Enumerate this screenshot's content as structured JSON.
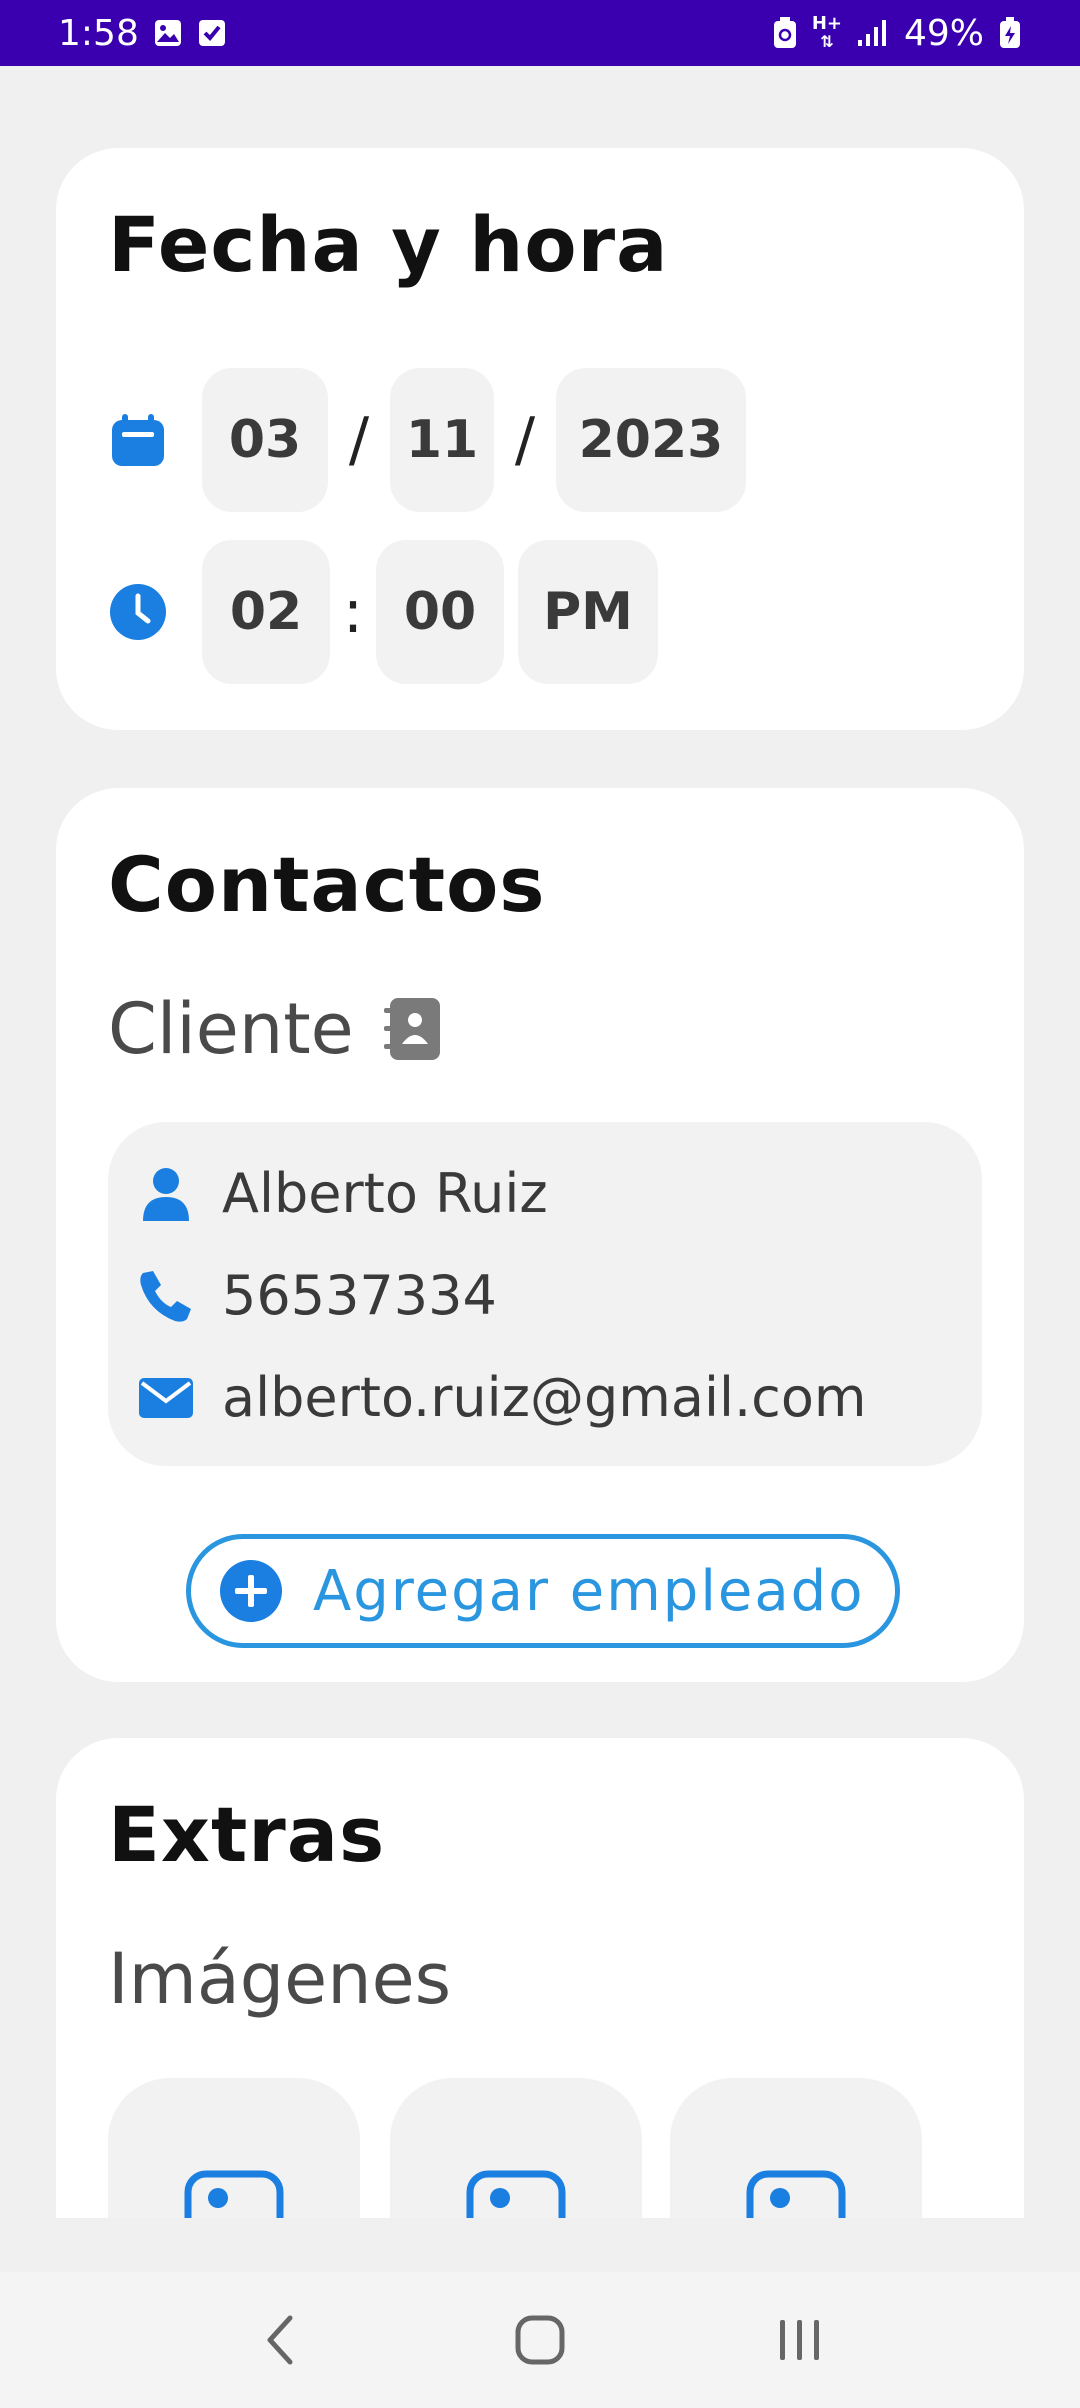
{
  "status_bar": {
    "time": "1:58",
    "battery": "49%",
    "network": "H+"
  },
  "datetime_card": {
    "title": "Fecha y hora",
    "date": {
      "day": "03",
      "sep1": "/",
      "month": "11",
      "sep2": "/",
      "year": "2023"
    },
    "time": {
      "hour": "02",
      "sep": ":",
      "minute": "00",
      "period": "PM"
    }
  },
  "contacts_card": {
    "title": "Contactos",
    "client_label": "Cliente",
    "client": {
      "name": "Alberto Ruiz",
      "phone": "56537334",
      "email": "alberto.ruiz@gmail.com"
    },
    "add_employee_label": "Agregar empleado"
  },
  "extras_card": {
    "title": "Extras",
    "images_label": "Imágenes"
  },
  "colors": {
    "status_bar": "#3a00b0",
    "accent": "#1a7fe0",
    "button_outline": "#2b96e0"
  },
  "icons": {
    "date": "calendar-icon",
    "time": "clock-icon",
    "client": "contact-book-icon",
    "name": "person-icon",
    "phone": "phone-icon",
    "email": "mail-icon",
    "add": "plus-circle-icon",
    "image": "image-placeholder-icon"
  }
}
